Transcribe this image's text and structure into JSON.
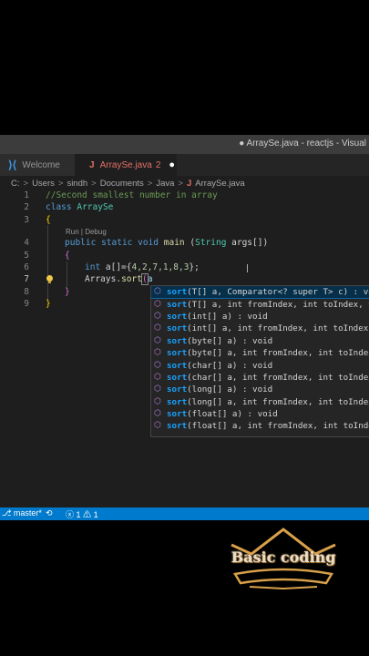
{
  "window": {
    "title": "● ArraySe.java - reactjs - Visual"
  },
  "tabs": [
    {
      "label": "Welcome",
      "icon": "vscode-icon"
    },
    {
      "label": "ArraySe.java",
      "icon": "java-icon",
      "icon_text": "J",
      "badge": "2",
      "modified": "●"
    }
  ],
  "breadcrumb": {
    "items": [
      "C:",
      "Users",
      "sindh",
      "Documents",
      "Java"
    ],
    "file_icon": "J",
    "file": "ArraySe.java",
    "separator": ">"
  },
  "codelens": "Run | Debug",
  "code": {
    "line_numbers": [
      "1",
      "2",
      "3",
      "4",
      "5",
      "6",
      "7",
      "8",
      "9"
    ],
    "line1": "//Second smallest number in array",
    "line2_kw": "class",
    "line2_name": "ArraySe",
    "line3": "{",
    "line4_kw1": "public",
    "line4_kw2": "static",
    "line4_kw3": "void",
    "line4_fn": "main",
    "line4_open": " (",
    "line4_type": "String",
    "line4_rest": " args[])",
    "line5": "{",
    "line6_kw": "int",
    "line6_a": " a[]={",
    "line6_nums": "4,2,7,1,8,3",
    "line6_end": "};",
    "line7_obj": "Arrays",
    "line7_dot": ".",
    "line7_fn": "sort",
    "line7_open": "(",
    "line7_arg": "a",
    "line8": "}",
    "line9": "}"
  },
  "suggestions": [
    {
      "prefix": "sort",
      "rest": "(T[] a, Comparator<? super T> c) : void"
    },
    {
      "prefix": "sort",
      "rest": "(T[] a, int fromIndex, int toIndex, Comparator"
    },
    {
      "prefix": "sort",
      "rest": "(int[] a) : void"
    },
    {
      "prefix": "sort",
      "rest": "(int[] a, int fromIndex, int toIndex) : void"
    },
    {
      "prefix": "sort",
      "rest": "(byte[] a) : void"
    },
    {
      "prefix": "sort",
      "rest": "(byte[] a, int fromIndex, int toIndex) : void"
    },
    {
      "prefix": "sort",
      "rest": "(char[] a) : void"
    },
    {
      "prefix": "sort",
      "rest": "(char[] a, int fromIndex, int toIndex) : void"
    },
    {
      "prefix": "sort",
      "rest": "(long[] a) : void"
    },
    {
      "prefix": "sort",
      "rest": "(long[] a, int fromIndex, int toIndex) : void"
    },
    {
      "prefix": "sort",
      "rest": "(float[] a) : void"
    },
    {
      "prefix": "sort",
      "rest": "(float[] a, int fromIndex, int toIndex) : void"
    }
  ],
  "statusbar": {
    "branch": "master*",
    "branch_icon": "⎇",
    "sync": "⟲",
    "errors": "1",
    "warnings": "1",
    "error_icon": "ⓧ",
    "warning_icon": "⚠"
  },
  "watermark": {
    "text": "Basic coding"
  },
  "colors": {
    "statusbar": "#007acc",
    "editor_bg": "#1e1e1e",
    "suggest_highlight": "#18a3ff",
    "tab_modified": "#e37067"
  }
}
